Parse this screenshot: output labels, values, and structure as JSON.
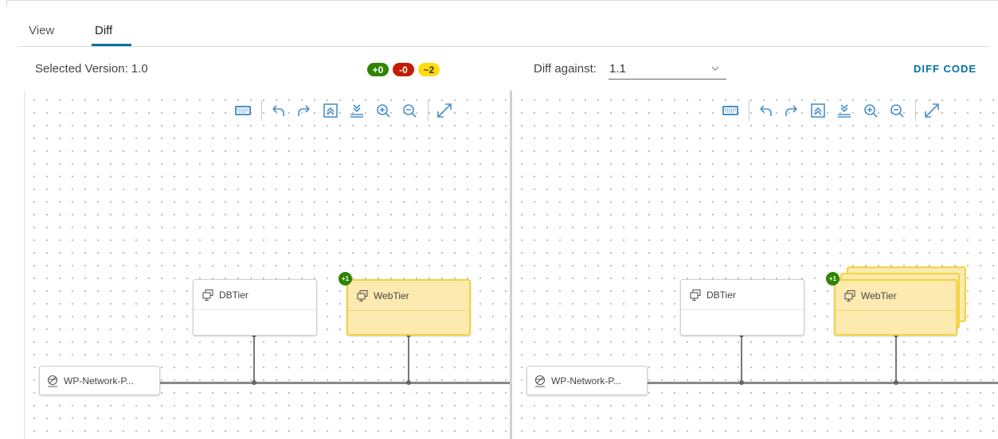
{
  "tabs": [
    {
      "label": "View"
    },
    {
      "label": "Diff"
    }
  ],
  "header": {
    "selected_version_label": "Selected Version: 1.0",
    "badges": {
      "added": "+0",
      "removed": "-0",
      "changed": "~2"
    },
    "diff_against_label": "Diff against:",
    "diff_against_value": "1.1",
    "diff_code_button": "DIFF CODE"
  },
  "canvas_left": {
    "nodes": [
      {
        "label": "DBTier",
        "status": "unchanged"
      },
      {
        "label": "WebTier",
        "status": "changed",
        "badge": "+1"
      }
    ],
    "network": {
      "label": "WP-Network-P..."
    }
  },
  "canvas_right": {
    "nodes": [
      {
        "label": "DBTier",
        "status": "unchanged"
      },
      {
        "label": "WebTier",
        "status": "changed",
        "badge": "+1"
      }
    ],
    "network": {
      "label": "WP-Network-P..."
    }
  },
  "toolbar_icons": [
    "keyboard-icon",
    "undo-icon",
    "redo-icon",
    "fit-top-icon",
    "fit-bottom-icon",
    "zoom-in-icon",
    "zoom-out-icon",
    "expand-icon"
  ],
  "colors": {
    "accent": "#0072a3",
    "added": "#2f8400",
    "removed": "#c21d00",
    "changed": "#ffdc0b",
    "changed_node_bg": "#fdeab0"
  }
}
